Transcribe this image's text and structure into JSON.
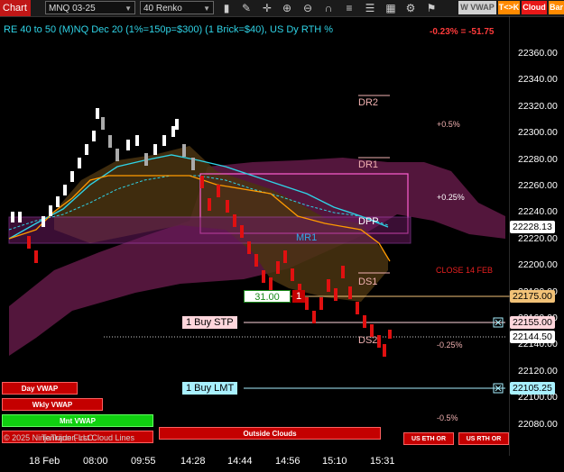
{
  "toolbar": {
    "chart_label": "Chart",
    "instrument": "MNQ 03-25",
    "bar_type": "40 Renko",
    "wvwap": "W VWAP",
    "tck": "T<>K",
    "cloud": "Cloud",
    "bar": "Bar",
    "icons": [
      "bar-style-icon",
      "pencil-icon",
      "crosshair-icon",
      "zoom-in-icon",
      "zoom-out-icon",
      "magnet-icon",
      "lines-icon",
      "list-icon",
      "table-icon",
      "gear-icon",
      "strategy-icon"
    ]
  },
  "header": {
    "title": "RE 40 to 50 (M)NQ Dec 20 (1%=150p=$300) (1 Brick=$40), US Dy RTH %",
    "pnl": "-0.23% = -51.75"
  },
  "y_axis": {
    "ticks": [
      "22360.00",
      "22340.00",
      "22320.00",
      "22300.00",
      "22280.00",
      "22260.00",
      "22240.00",
      "22220.00",
      "22200.00",
      "22180.00",
      "22160.00",
      "22140.00",
      "22120.00",
      "22100.00",
      "22080.00"
    ],
    "price_tags": [
      {
        "label": "22228.13",
        "bg": "#ffffff",
        "fg": "#000000"
      },
      {
        "label": "22175.00",
        "bg": "#f2c277",
        "fg": "#000000"
      },
      {
        "label": "22155.00",
        "bg": "#ffd6dc",
        "fg": "#000000"
      },
      {
        "label": "22144.50",
        "bg": "#ffffff",
        "fg": "#000000"
      },
      {
        "label": "22105.25",
        "bg": "#a8f0ff",
        "fg": "#000000"
      }
    ]
  },
  "x_axis": {
    "labels": [
      "18 Feb",
      "08:00",
      "09:55",
      "14:28",
      "14:44",
      "14:56",
      "15:10",
      "15:31"
    ]
  },
  "levels": {
    "dr2": "DR2",
    "dr1": "DR1",
    "dpp": "DPP",
    "mr1": "MR1",
    "ds1": "DS1",
    "ds2": "DS2",
    "close": "CLOSE 14 FEB"
  },
  "pct_labels": {
    "p05": "+0.5%",
    "p025": "+0.25%",
    "m025": "-0.25%",
    "m05": "-0.5%"
  },
  "orders": {
    "buy_stp": "1 Buy STP",
    "buy_lmt": "1 Buy LMT",
    "position_price": "31.00",
    "position_qty": "1"
  },
  "panel_buttons": {
    "day_vwap": "Day VWAP",
    "wkly_vwap": "Wkly VWAP",
    "mnt_vwap": "Mnt VWAP",
    "outside_clouds": "Outside Clouds",
    "us_eth": "US ETH OR",
    "us_rth": "US RTH OR"
  },
  "footer": "© 2025 NinjaTrader, LLC",
  "footer_overlay": "Tenkijun First Cloud Lines",
  "colors": {
    "accent": "#2fd3e6",
    "down": "#e01010",
    "up": "#ffffff",
    "cloud": "#7a1f5a"
  }
}
